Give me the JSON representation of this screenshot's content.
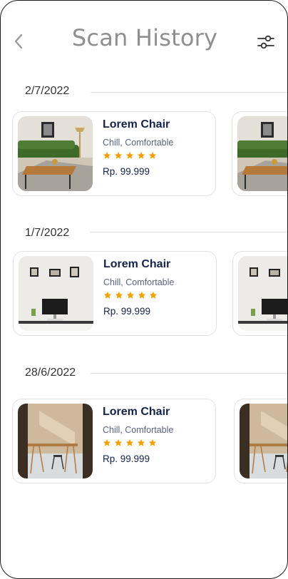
{
  "header": {
    "title": "Scan History",
    "back_icon": "chevron-left-icon",
    "filter_icon": "sliders-icon"
  },
  "colors": {
    "title": "#8f8f8f",
    "product_name": "#15224a",
    "star": "#f4a20c",
    "card_border": "#e2e2e2"
  },
  "groups": [
    {
      "date": "2/7/2022",
      "items": [
        {
          "name": "Lorem Chair",
          "subtitle": "Chill, Comfortable",
          "rating": 5,
          "price": "Rp. 99.999",
          "image": "green-sofa-living-room"
        }
      ]
    },
    {
      "date": "1/7/2022",
      "items": [
        {
          "name": "Lorem Chair",
          "subtitle": "Chill, Comfortable",
          "rating": 5,
          "price": "Rp. 99.999",
          "image": "white-desk-workspace"
        }
      ]
    },
    {
      "date": "28/6/2022",
      "items": [
        {
          "name": "Lorem Chair",
          "subtitle": "Chill, Comfortable",
          "rating": 5,
          "price": "Rp. 99.999",
          "image": "wooden-table-sunlit-room"
        }
      ]
    }
  ]
}
